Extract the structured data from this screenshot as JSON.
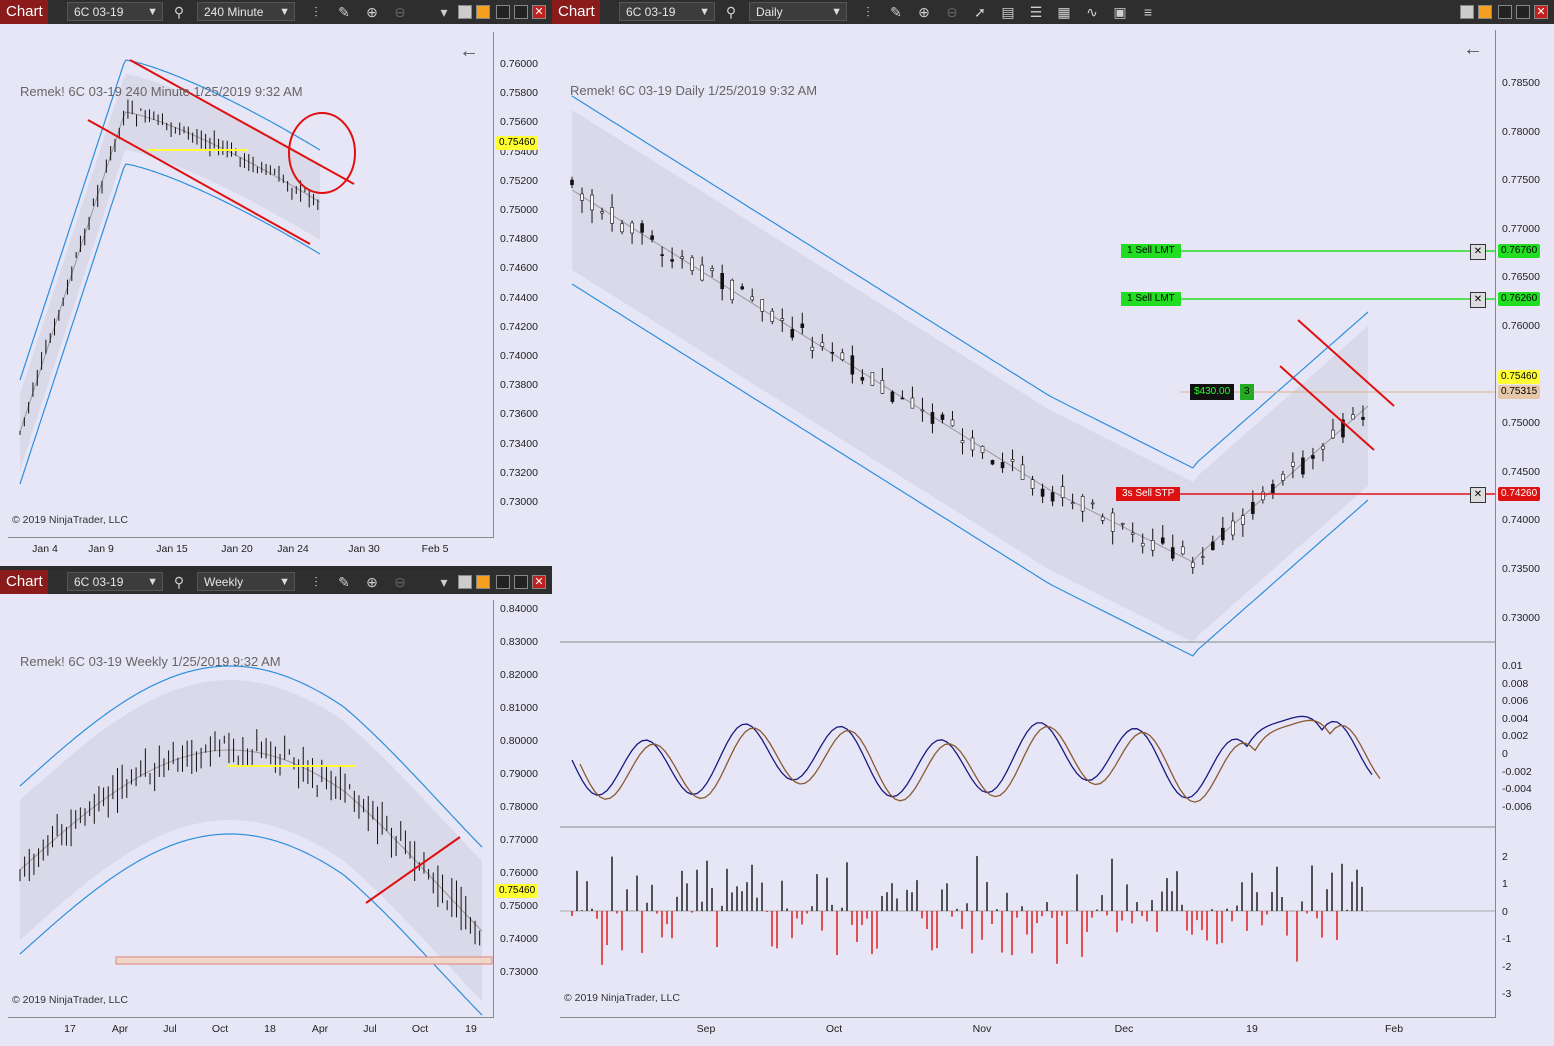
{
  "windows": {
    "top_left": {
      "title": "Chart",
      "instrument": "6C 03-19",
      "interval": "240 Minute",
      "info": "Remek!  6C 03-19  240 Minute  1/25/2019 9:32 AM",
      "copyright": "© 2019 NinjaTrader, LLC",
      "y_ticks": [
        "0.76000",
        "0.75800",
        "0.75600",
        "0.75400",
        "0.75200",
        "0.75000",
        "0.74800",
        "0.74600",
        "0.74400",
        "0.74200",
        "0.74000",
        "0.73800",
        "0.73600",
        "0.73400",
        "0.73200",
        "0.73000"
      ],
      "x_ticks": [
        "Jan 4",
        "Jan 9",
        "Jan 15",
        "Jan 20",
        "Jan 24",
        "Jan 30",
        "Feb 5"
      ],
      "price_tag": "0.75460"
    },
    "bottom_left": {
      "title": "Chart",
      "instrument": "6C 03-19",
      "interval": "Weekly",
      "info": "Remek!  6C 03-19  Weekly  1/25/2019 9:32 AM",
      "copyright": "© 2019 NinjaTrader, LLC",
      "y_ticks": [
        "0.84000",
        "0.83000",
        "0.82000",
        "0.81000",
        "0.80000",
        "0.79000",
        "0.78000",
        "0.77000",
        "0.76000",
        "0.75000",
        "0.74000",
        "0.73000"
      ],
      "x_ticks": [
        "17",
        "Apr",
        "Jul",
        "Oct",
        "18",
        "Apr",
        "Jul",
        "Oct",
        "19"
      ],
      "price_tag": "0.75460"
    },
    "right": {
      "title": "Chart",
      "instrument": "6C 03-19",
      "interval": "Daily",
      "info": "Remek!  6C 03-19  Daily  1/25/2019 9:32 AM",
      "copyright": "© 2019 NinjaTrader, LLC",
      "y_ticks": [
        "0.78500",
        "0.78000",
        "0.77500",
        "0.77000",
        "0.76500",
        "0.76000",
        "0.75500",
        "0.75000",
        "0.74500",
        "0.74000",
        "0.73500",
        "0.73000"
      ],
      "osc_ticks": [
        "0.01",
        "0.008",
        "0.006",
        "0.004",
        "0.002",
        "0",
        "-0.002",
        "-0.004",
        "-0.006"
      ],
      "hist_ticks": [
        "2",
        "1",
        "0",
        "-1",
        "-2",
        "-3"
      ],
      "x_ticks": [
        "Sep",
        "Oct",
        "Nov",
        "Dec",
        "19",
        "Feb"
      ],
      "orders": [
        {
          "label": "1  Sell LMT",
          "price": "0.76760",
          "color": "#22dd22"
        },
        {
          "label": "1  Sell LMT",
          "price": "0.76260",
          "color": "#22dd22"
        },
        {
          "label": "3s  Sell STP",
          "price": "0.74260",
          "color": "#dd1111"
        }
      ],
      "position_pnl": "$430.00",
      "position_qty": "3",
      "price_tag": "0.75460",
      "avg_tag": "0.75315"
    }
  },
  "colors": {
    "title_bg": "#8b1a1a",
    "chart_bg": "#e6e6f6",
    "band": "#2e8fdd",
    "channel": "#e01010",
    "price_tag": "#ffff33"
  }
}
